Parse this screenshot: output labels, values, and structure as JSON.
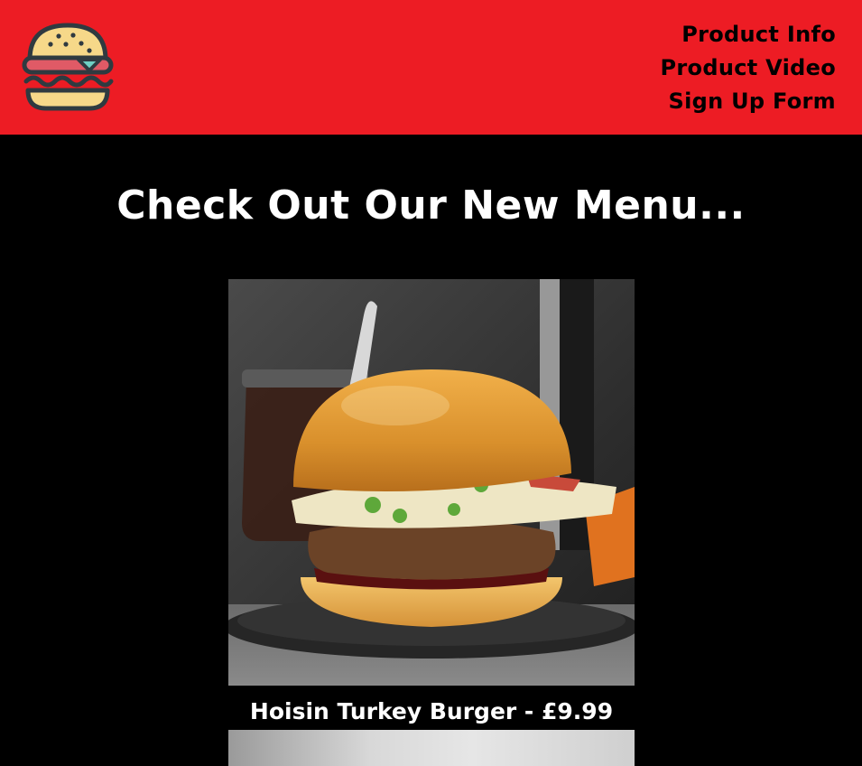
{
  "header": {
    "background_color": "#ed1c24",
    "logo": {
      "icon": "burger-logo-icon"
    },
    "nav": [
      {
        "label": "Product Info"
      },
      {
        "label": "Product Video"
      },
      {
        "label": "Sign Up Form"
      }
    ]
  },
  "main": {
    "title": "Check Out Our New Menu...",
    "menu_items": [
      {
        "image": "hoisin-turkey-burger-photo",
        "caption": "Hoisin Turkey Burger - £9.99"
      }
    ]
  }
}
